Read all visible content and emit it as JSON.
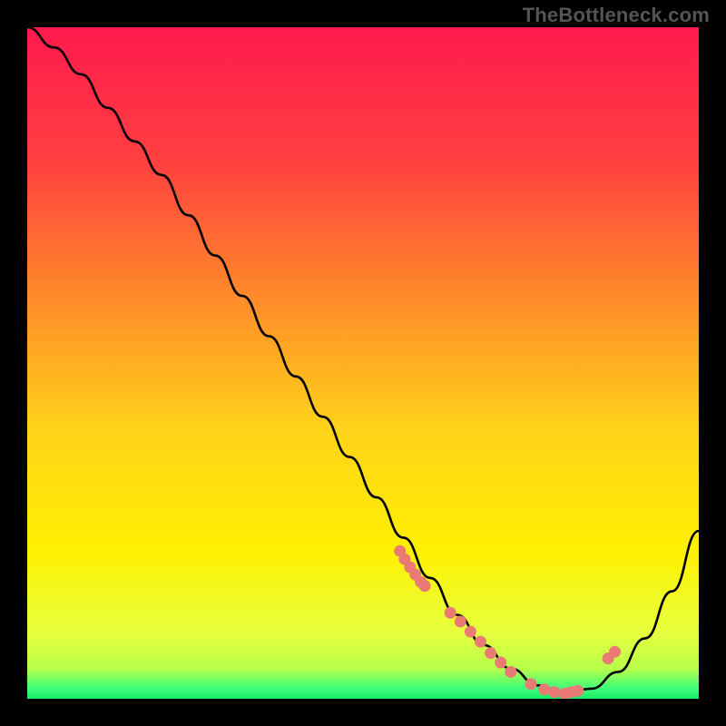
{
  "watermark": "TheBottleneck.com",
  "chart_data": {
    "type": "line",
    "title": "",
    "xlabel": "",
    "ylabel": "",
    "xlim": [
      0,
      100
    ],
    "ylim": [
      0,
      100
    ],
    "grid": false,
    "legend": false,
    "gradient_stops": [
      {
        "offset": 0.0,
        "color": "#ff1a4d"
      },
      {
        "offset": 0.2,
        "color": "#ff4040"
      },
      {
        "offset": 0.4,
        "color": "#ff8a2a"
      },
      {
        "offset": 0.6,
        "color": "#ffd31a"
      },
      {
        "offset": 0.78,
        "color": "#fff000"
      },
      {
        "offset": 0.9,
        "color": "#e8ff3e"
      },
      {
        "offset": 0.955,
        "color": "#b8ff4a"
      },
      {
        "offset": 0.985,
        "color": "#3dff7a"
      },
      {
        "offset": 1.0,
        "color": "#18e86a"
      }
    ],
    "series": [
      {
        "name": "bottleneck-curve",
        "type": "line",
        "color": "#000000",
        "x": [
          0,
          4,
          8,
          12,
          16,
          20,
          24,
          28,
          32,
          36,
          40,
          44,
          48,
          52,
          56,
          60,
          64,
          68,
          72,
          76,
          80,
          84,
          88,
          92,
          96,
          100
        ],
        "y": [
          100,
          97,
          93,
          88,
          83,
          78,
          72,
          66,
          60,
          54,
          48,
          42,
          36,
          30,
          24,
          18,
          12.5,
          8,
          4.5,
          2,
          0.8,
          1.5,
          4,
          9,
          16,
          25
        ]
      },
      {
        "name": "highlight-points",
        "type": "scatter",
        "color": "#e97b74",
        "x": [
          55.5,
          56.2,
          57.0,
          57.8,
          58.6,
          59.2,
          63.0,
          64.5,
          66.0,
          67.5,
          69.0,
          70.5,
          72.0,
          75.0,
          77.0,
          78.5,
          80.0,
          81.0,
          82.0,
          86.5,
          87.5
        ],
        "y": [
          22.0,
          20.8,
          19.6,
          18.5,
          17.4,
          16.8,
          12.8,
          11.5,
          10.0,
          8.5,
          6.8,
          5.4,
          4.0,
          2.2,
          1.4,
          1.0,
          0.8,
          1.0,
          1.2,
          6.0,
          7.0
        ]
      }
    ]
  }
}
